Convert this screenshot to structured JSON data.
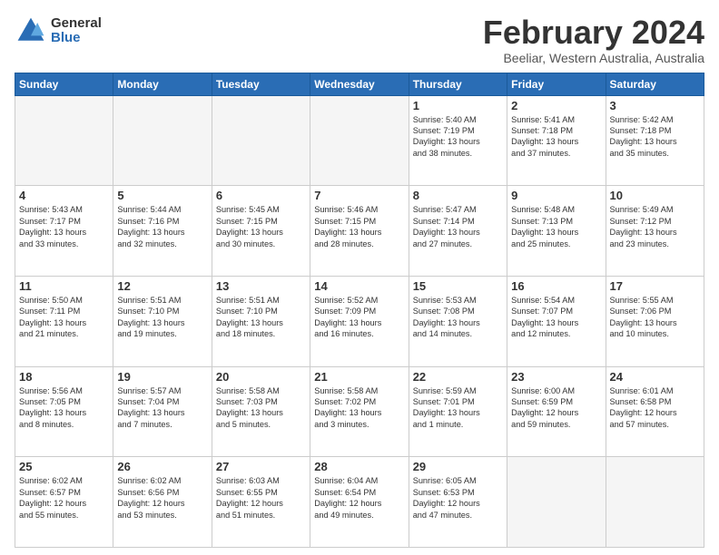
{
  "header": {
    "logo_general": "General",
    "logo_blue": "Blue",
    "title": "February 2024",
    "subtitle": "Beeliar, Western Australia, Australia"
  },
  "days": [
    "Sunday",
    "Monday",
    "Tuesday",
    "Wednesday",
    "Thursday",
    "Friday",
    "Saturday"
  ],
  "rows": [
    [
      {
        "num": "",
        "text": "",
        "empty": true
      },
      {
        "num": "",
        "text": "",
        "empty": true
      },
      {
        "num": "",
        "text": "",
        "empty": true
      },
      {
        "num": "",
        "text": "",
        "empty": true
      },
      {
        "num": "1",
        "text": "Sunrise: 5:40 AM\nSunset: 7:19 PM\nDaylight: 13 hours\nand 38 minutes.",
        "empty": false
      },
      {
        "num": "2",
        "text": "Sunrise: 5:41 AM\nSunset: 7:18 PM\nDaylight: 13 hours\nand 37 minutes.",
        "empty": false
      },
      {
        "num": "3",
        "text": "Sunrise: 5:42 AM\nSunset: 7:18 PM\nDaylight: 13 hours\nand 35 minutes.",
        "empty": false
      }
    ],
    [
      {
        "num": "4",
        "text": "Sunrise: 5:43 AM\nSunset: 7:17 PM\nDaylight: 13 hours\nand 33 minutes.",
        "empty": false
      },
      {
        "num": "5",
        "text": "Sunrise: 5:44 AM\nSunset: 7:16 PM\nDaylight: 13 hours\nand 32 minutes.",
        "empty": false
      },
      {
        "num": "6",
        "text": "Sunrise: 5:45 AM\nSunset: 7:15 PM\nDaylight: 13 hours\nand 30 minutes.",
        "empty": false
      },
      {
        "num": "7",
        "text": "Sunrise: 5:46 AM\nSunset: 7:15 PM\nDaylight: 13 hours\nand 28 minutes.",
        "empty": false
      },
      {
        "num": "8",
        "text": "Sunrise: 5:47 AM\nSunset: 7:14 PM\nDaylight: 13 hours\nand 27 minutes.",
        "empty": false
      },
      {
        "num": "9",
        "text": "Sunrise: 5:48 AM\nSunset: 7:13 PM\nDaylight: 13 hours\nand 25 minutes.",
        "empty": false
      },
      {
        "num": "10",
        "text": "Sunrise: 5:49 AM\nSunset: 7:12 PM\nDaylight: 13 hours\nand 23 minutes.",
        "empty": false
      }
    ],
    [
      {
        "num": "11",
        "text": "Sunrise: 5:50 AM\nSunset: 7:11 PM\nDaylight: 13 hours\nand 21 minutes.",
        "empty": false
      },
      {
        "num": "12",
        "text": "Sunrise: 5:51 AM\nSunset: 7:10 PM\nDaylight: 13 hours\nand 19 minutes.",
        "empty": false
      },
      {
        "num": "13",
        "text": "Sunrise: 5:51 AM\nSunset: 7:10 PM\nDaylight: 13 hours\nand 18 minutes.",
        "empty": false
      },
      {
        "num": "14",
        "text": "Sunrise: 5:52 AM\nSunset: 7:09 PM\nDaylight: 13 hours\nand 16 minutes.",
        "empty": false
      },
      {
        "num": "15",
        "text": "Sunrise: 5:53 AM\nSunset: 7:08 PM\nDaylight: 13 hours\nand 14 minutes.",
        "empty": false
      },
      {
        "num": "16",
        "text": "Sunrise: 5:54 AM\nSunset: 7:07 PM\nDaylight: 13 hours\nand 12 minutes.",
        "empty": false
      },
      {
        "num": "17",
        "text": "Sunrise: 5:55 AM\nSunset: 7:06 PM\nDaylight: 13 hours\nand 10 minutes.",
        "empty": false
      }
    ],
    [
      {
        "num": "18",
        "text": "Sunrise: 5:56 AM\nSunset: 7:05 PM\nDaylight: 13 hours\nand 8 minutes.",
        "empty": false
      },
      {
        "num": "19",
        "text": "Sunrise: 5:57 AM\nSunset: 7:04 PM\nDaylight: 13 hours\nand 7 minutes.",
        "empty": false
      },
      {
        "num": "20",
        "text": "Sunrise: 5:58 AM\nSunset: 7:03 PM\nDaylight: 13 hours\nand 5 minutes.",
        "empty": false
      },
      {
        "num": "21",
        "text": "Sunrise: 5:58 AM\nSunset: 7:02 PM\nDaylight: 13 hours\nand 3 minutes.",
        "empty": false
      },
      {
        "num": "22",
        "text": "Sunrise: 5:59 AM\nSunset: 7:01 PM\nDaylight: 13 hours\nand 1 minute.",
        "empty": false
      },
      {
        "num": "23",
        "text": "Sunrise: 6:00 AM\nSunset: 6:59 PM\nDaylight: 12 hours\nand 59 minutes.",
        "empty": false
      },
      {
        "num": "24",
        "text": "Sunrise: 6:01 AM\nSunset: 6:58 PM\nDaylight: 12 hours\nand 57 minutes.",
        "empty": false
      }
    ],
    [
      {
        "num": "25",
        "text": "Sunrise: 6:02 AM\nSunset: 6:57 PM\nDaylight: 12 hours\nand 55 minutes.",
        "empty": false
      },
      {
        "num": "26",
        "text": "Sunrise: 6:02 AM\nSunset: 6:56 PM\nDaylight: 12 hours\nand 53 minutes.",
        "empty": false
      },
      {
        "num": "27",
        "text": "Sunrise: 6:03 AM\nSunset: 6:55 PM\nDaylight: 12 hours\nand 51 minutes.",
        "empty": false
      },
      {
        "num": "28",
        "text": "Sunrise: 6:04 AM\nSunset: 6:54 PM\nDaylight: 12 hours\nand 49 minutes.",
        "empty": false
      },
      {
        "num": "29",
        "text": "Sunrise: 6:05 AM\nSunset: 6:53 PM\nDaylight: 12 hours\nand 47 minutes.",
        "empty": false
      },
      {
        "num": "",
        "text": "",
        "empty": true
      },
      {
        "num": "",
        "text": "",
        "empty": true
      }
    ]
  ]
}
